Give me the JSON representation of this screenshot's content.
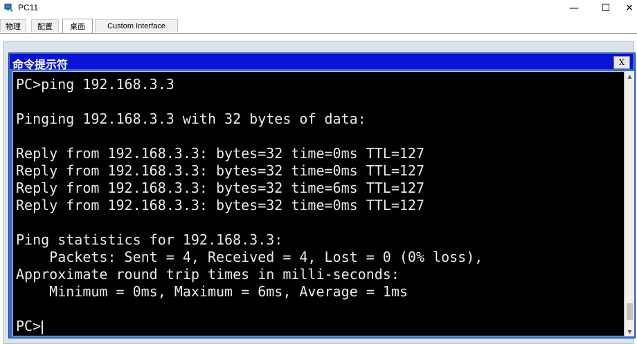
{
  "window": {
    "title": "PC11",
    "minimize_glyph": "—",
    "maximize_glyph": "☐",
    "close_glyph": "✕"
  },
  "tabs": [
    {
      "label": "物理"
    },
    {
      "label": "配置"
    },
    {
      "label": "桌面"
    },
    {
      "label": "Custom Interface"
    }
  ],
  "active_tab": "桌面",
  "command_prompt": {
    "title": "命令提示符",
    "close_label": "X",
    "lines": [
      "PC>ping 192.168.3.3",
      "",
      "Pinging 192.168.3.3 with 32 bytes of data:",
      "",
      "Reply from 192.168.3.3: bytes=32 time=0ms TTL=127",
      "Reply from 192.168.3.3: bytes=32 time=0ms TTL=127",
      "Reply from 192.168.3.3: bytes=32 time=6ms TTL=127",
      "Reply from 192.168.3.3: bytes=32 time=0ms TTL=127",
      "",
      "Ping statistics for 192.168.3.3:",
      "    Packets: Sent = 4, Received = 4, Lost = 0 (0% loss),",
      "Approximate round trip times in milli-seconds:",
      "    Minimum = 0ms, Maximum = 6ms, Average = 1ms",
      "",
      "PC>"
    ]
  },
  "colors": {
    "cmd_titlebar": "#0a14d8",
    "console_bg": "#000000",
    "console_text": "#e9e9e9"
  }
}
